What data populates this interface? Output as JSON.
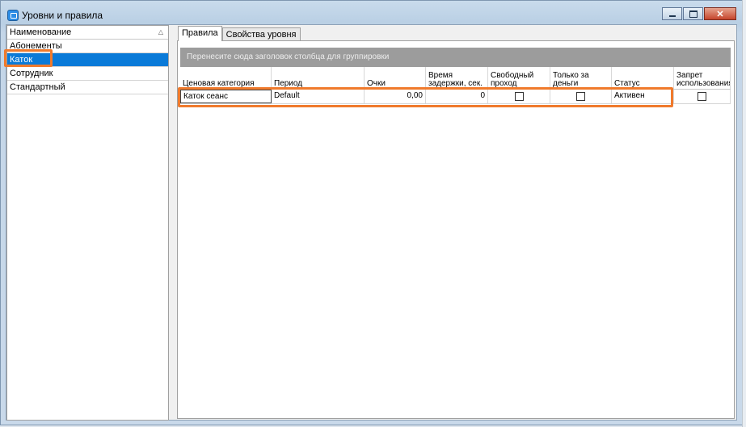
{
  "window": {
    "title": "Уровни и правила",
    "close_glyph": "✕"
  },
  "left_list": {
    "header": "Наименование",
    "sort_glyph": "△",
    "items": [
      {
        "label": "Абонементы"
      },
      {
        "label": "Каток"
      },
      {
        "label": "Сотрудник"
      },
      {
        "label": "Стандартный"
      }
    ],
    "selected_index": 1
  },
  "tabs": [
    {
      "label": "Правила"
    },
    {
      "label": "Свойства уровня"
    }
  ],
  "group_panel_text": "Перенесите сюда заголовок столбца для группировки",
  "grid": {
    "columns": [
      "Ценовая категория",
      "Период",
      "Очки",
      "Время задержки, сек.",
      "Свободный проход",
      "Только за деньги",
      "Статус",
      "Запрет использования"
    ],
    "rows": [
      {
        "price_category": "Каток сеанс",
        "period": "Default",
        "points": "0,00",
        "delay_sec": "0",
        "free_pass": false,
        "money_only": false,
        "status": "Активен",
        "usage_ban": false
      }
    ]
  },
  "colors": {
    "selection": "#0a7ad8",
    "annotation": "#f07a2c",
    "group_panel": "#9c9c9c"
  },
  "icons": [
    "app-icon",
    "minimize-icon",
    "maximize-icon",
    "close-icon",
    "sort-asc-icon",
    "checkbox"
  ]
}
